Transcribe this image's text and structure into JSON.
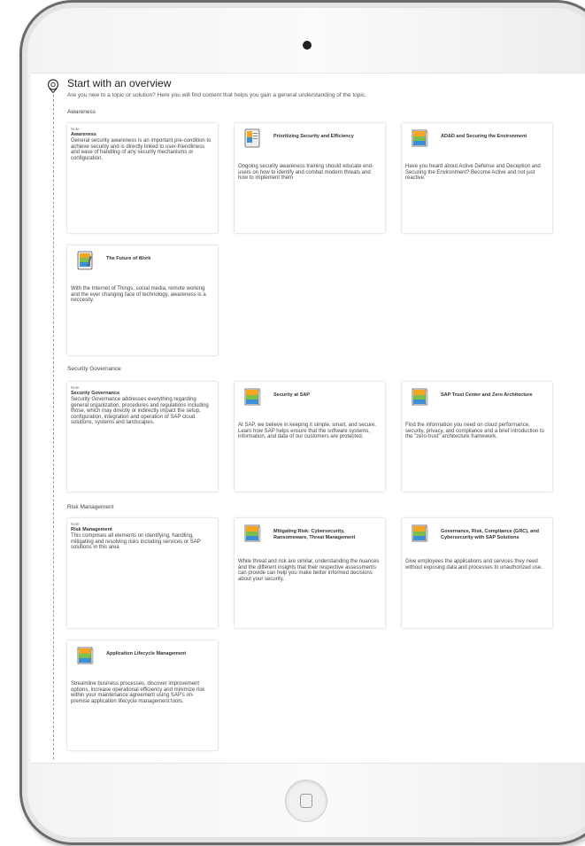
{
  "overview": {
    "title": "Start with an overview",
    "subtitle": "Are you new to a topic or solution? Here you will find content that helps you gain a general understanding of the topic."
  },
  "note_tag": "Note",
  "sections": [
    {
      "label": "Awareness",
      "note": {
        "heading": "Awareness",
        "body": "General security awareness is an important pre-condition to achieve security and is directly linked to user-friendliness and ease of handling of any security mechanisms or configuration."
      },
      "cards": [
        {
          "title": "Prioritizing Security and Efficiency",
          "body": "Ongoing security awareness training should educate end-users on how to identify and combat modern threats and how to implement them",
          "icon": "tablet-document-icon"
        },
        {
          "title": "AD&D and Securing the Environment",
          "body": "Have you heard about Active Defense and Deception and Securing the Environment? Become Active and not just reactive.",
          "icon": "book-stack-icon"
        },
        {
          "title": "The Future of Work",
          "body": "With the Internet of Things, social media, remote working and the ever changing face of technology, awareness is a neccesity.",
          "icon": "tablet-pen-icon"
        }
      ]
    },
    {
      "label": "Security Governance",
      "note": {
        "heading": "Security Governance",
        "body": "Security Governance addresses everything regarding general organization, procedures and regulations including those, which may directly or indirectly impact the setup, configuration, integration and operation of SAP cloud solutions, systems and landscapes."
      },
      "cards": [
        {
          "title": "Security at SAP",
          "body": "At SAP, we believe in keeping it simple, smart, and secure. Learn how SAP helps ensure that the software systems, information, and data of our customers are protected.",
          "icon": "book-stack-icon"
        },
        {
          "title": "SAP Trust Center and Zero Architecture",
          "body": "Find the information you need on cloud performance, security, privacy, and compliance and a brief introduction to the \"zero-trust\" architecture framework.",
          "icon": "book-stack-icon"
        }
      ]
    },
    {
      "label": "Risk Management",
      "note": {
        "heading": "Risk Management",
        "body": "This comprises all elements on identifying, handling, mitigating and resolving risks including services or SAP solutions in this area"
      },
      "cards": [
        {
          "title": "Mitigating Risk: Cybersecurity, Ransomeware, Threat Management",
          "body": "While threat and risk are similar, understanding the nuances and the different insights that their respective assessments can provide can help you make better informed decisions about your security.",
          "icon": "book-stack-icon"
        },
        {
          "title": "Governance, Risk, Compliance (GRC), and Cybersecurity with SAP Solutions",
          "body": "Give employees the applications and services they need without exposing data and processes to unauthorized use.",
          "icon": "book-stack-icon"
        },
        {
          "title": "Application Lifecycle Management",
          "body": "Streamline business processes, discover improvement options, increase operational efficiency and minimize risk within your maintenance agreement using SAP's on-premise application lifecycle management tools.",
          "icon": "book-stack-icon"
        }
      ]
    }
  ]
}
